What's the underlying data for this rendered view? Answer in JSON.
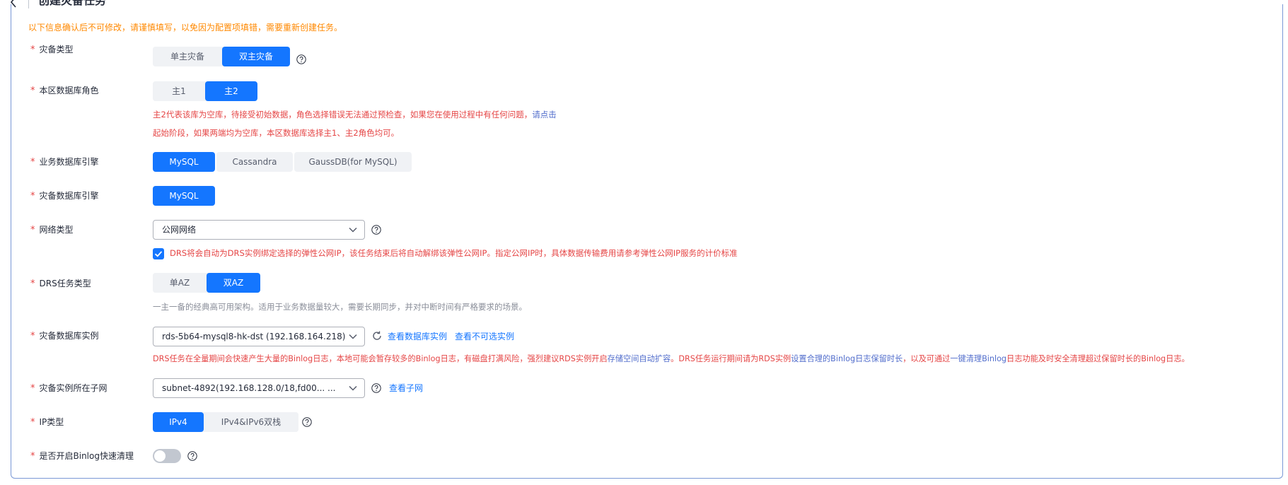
{
  "header": {
    "title": "创建灾备任务"
  },
  "notice": "以下信息确认后不可修改，请谨慎填写，以免因为配置项填错，需要重新创建任务。",
  "rows": {
    "dr_type": {
      "label": "灾备类型",
      "options": [
        "单主灾备",
        "双主灾备"
      ],
      "selected": "双主灾备"
    },
    "db_role": {
      "label": "本区数据库角色",
      "options": [
        "主1",
        "主2"
      ],
      "selected": "主2",
      "warn_line1": "主2代表该库为空库，待接受初始数据，角色选择错误无法通过预检查，如果您在使用过程中有任何问题，",
      "warn_link": "请点击",
      "warn_line2": "起始阶段，如果两端均为空库，本区数据库选择主1、主2角色均可。"
    },
    "biz_engine": {
      "label": "业务数据库引擎",
      "options": [
        "MySQL",
        "Cassandra",
        "GaussDB(for MySQL)"
      ],
      "selected": "MySQL"
    },
    "dr_engine": {
      "label": "灾备数据库引擎",
      "options": [
        "MySQL"
      ],
      "selected": "MySQL"
    },
    "network": {
      "label": "网络类型",
      "value": "公网网络",
      "checkbox_text": "DRS将会自动为DRS实例绑定选择的弹性公网IP，该任务结束后将自动解绑该弹性公网IP。指定公网IP时，具体数据传输费用请参考弹性公网IP服务的计价标准"
    },
    "task_type": {
      "label": "DRS任务类型",
      "options": [
        "单AZ",
        "双AZ"
      ],
      "selected": "双AZ",
      "hint": "一主一备的经典高可用架构。适用于业务数据量较大，需要长期同步，并对中断时间有严格要求的场景。"
    },
    "dr_instance": {
      "label": "灾备数据库实例",
      "value": "rds-5b64-mysql8-hk-dst (192.168.164.218)",
      "link1": "查看数据库实例",
      "link2": "查看不可选实例",
      "warn_a": "DRS任务在全量期间会快速产生大量的Binlog日志，本地可能会暂存较多的Binlog日志，有磁盘打满风险，强烈建议RDS实例开启",
      "warn_link_a": "存储空间自动扩容",
      "warn_b": "。DRS任务运行期间请为RDS实例",
      "warn_link_b": "设置合理的Binlog日志保留时长",
      "warn_c": "，以及可通过",
      "warn_link_c": "一键清理Binlog",
      "warn_d": "日志功能及时安全清理超过保留时长的Binlog日志。"
    },
    "subnet": {
      "label": "灾备实例所在子网",
      "value": "subnet-4892(192.168.128.0/18,fd00... ...",
      "link": "查看子网"
    },
    "ip_type": {
      "label": "IP类型",
      "options": [
        "IPv4",
        "IPv4&IPv6双栈"
      ],
      "selected": "IPv4"
    },
    "binlog": {
      "label": "是否开启Binlog快速清理",
      "enabled": false
    }
  },
  "colors": {
    "accent": "#1476ff",
    "warn": "#e54545",
    "notice": "#ff8800",
    "link": "#526ecc"
  }
}
